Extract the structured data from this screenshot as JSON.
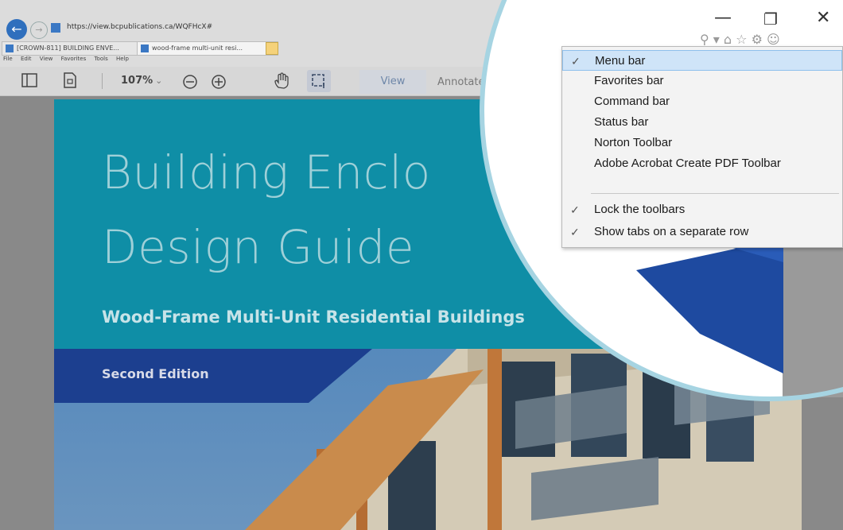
{
  "browser": {
    "url": "https://view.bcpublications.ca/WQFHcX#",
    "tabs": [
      {
        "label": "[CROWN-811] BUILDING ENVE..."
      },
      {
        "label": "wood-frame multi-unit resi...",
        "close": "×"
      }
    ],
    "menu_bar": [
      "File",
      "Edit",
      "View",
      "Favorites",
      "Tools",
      "Help"
    ],
    "window_controls": {
      "minimize": "—",
      "restore": "❐",
      "close": "✕"
    },
    "command_icons": "⚲ ▾  ⌂ ☆ ⚙ ☺"
  },
  "pdf_toolbar": {
    "zoom": "107%",
    "zoom_chevron": "⌄",
    "view_tab": "View",
    "annotate_tab": "Annotate"
  },
  "cover": {
    "title_line1": "Building Enclo",
    "title_line2": "Design Guide",
    "subtitle": "Wood-Frame Multi-Unit Residential Buildings",
    "edition": "Second Edition"
  },
  "context_menu": {
    "items": [
      {
        "label": "Menu bar",
        "checked": true,
        "highlighted": true
      },
      {
        "label": "Favorites bar",
        "checked": false
      },
      {
        "label": "Command bar",
        "checked": false
      },
      {
        "label": "Status bar",
        "checked": false
      },
      {
        "label": "Norton Toolbar",
        "checked": false
      },
      {
        "label": "Adobe Acrobat Create PDF Toolbar",
        "checked": false
      },
      {
        "label": "Lock the toolbars",
        "checked": true
      },
      {
        "label": "Show tabs on a separate row",
        "checked": true
      }
    ],
    "check_glyph": "✓"
  },
  "colors": {
    "teal_banner": "#0f8ea6",
    "navy_band": "#1c3f8f",
    "menu_highlight": "#cfe4f8",
    "magnifier_ring": "#a6d4e2"
  }
}
